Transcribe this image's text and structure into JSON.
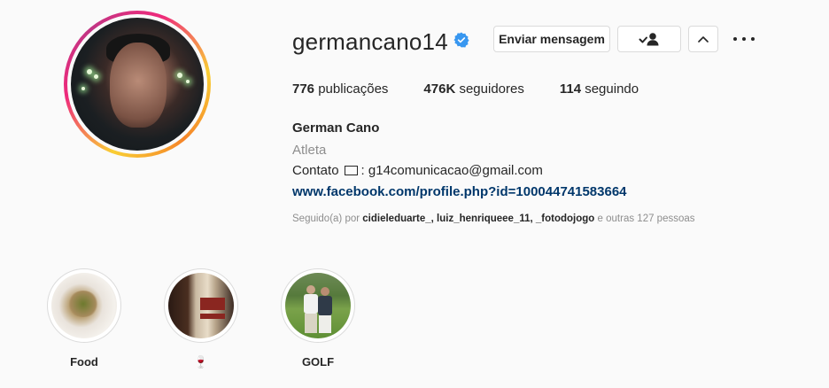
{
  "profile": {
    "username": "germancano14",
    "full_name": "German Cano",
    "category": "Atleta",
    "contact_prefix": "Contato",
    "contact_email": ": g14comunicacao@gmail.com",
    "link": "www.facebook.com/profile.php?id=100044741583664",
    "verified_icon": "verified-badge-icon",
    "verified_color": "#3897f0"
  },
  "actions": {
    "message_label": "Enviar mensagem",
    "following_icon": "person-check-icon",
    "suggestions_icon": "chevron-up-icon",
    "more_icon": "more-dots-icon"
  },
  "stats": [
    {
      "value": "776",
      "label": "publicações"
    },
    {
      "value": "476K",
      "label": "seguidores"
    },
    {
      "value": "114",
      "label": "seguindo"
    }
  ],
  "followed_by": {
    "prefix": "Seguido(a) por",
    "users": [
      "cidieleduarte_",
      "luiz_henriqueee_11",
      "_fotodojogo"
    ],
    "suffix": "e outras 127 pessoas"
  },
  "highlights": [
    {
      "label": "Food"
    },
    {
      "label": "🍷"
    },
    {
      "label": "GOLF"
    }
  ]
}
